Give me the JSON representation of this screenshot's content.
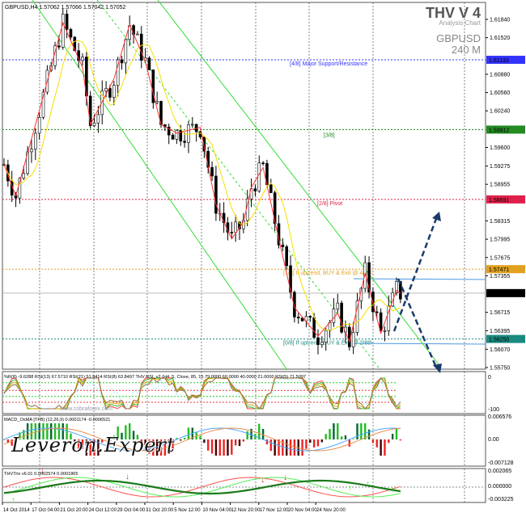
{
  "header": {
    "symbol_info": "GBPUSD,H4",
    "ohlc": "1.57062 1.57066 1.57042 1.57052"
  },
  "brand": {
    "title": "THV V 4",
    "subtitle": "Analysis Chart",
    "symbol": "GBPUSD",
    "timeframe": "240 M"
  },
  "price_axis": {
    "ticks": [
      "1.61840",
      "1.61520",
      "1.60880",
      "1.60560",
      "1.60240",
      "1.59600",
      "1.59275",
      "1.58955",
      "1.58315",
      "1.57995",
      "1.57675",
      "1.57355",
      "1.56715",
      "1.56395",
      "1.56070",
      "1.55750"
    ]
  },
  "levels": [
    {
      "price": "1.61133",
      "label": "[4/8] Major Support/Resistance",
      "color": "#3333ff"
    },
    {
      "price": "1.59912",
      "label": "[3/8]",
      "color": "#228b22"
    },
    {
      "price": "1.58691",
      "label": "[2/8] Pivot",
      "color": "#e0204a"
    },
    {
      "price": "1.57471",
      "label": "[1/8] If uptrend, BUY & Exit @ 4/8th",
      "color": "#e0a020"
    },
    {
      "price": "1.56250",
      "label": "[0/8] If uptrend, BUY & Exit @ 2/8th",
      "color": "#1a8a80"
    }
  ],
  "current_price": "1.57052",
  "price_path": [
    [
      0,
      1.593
    ],
    [
      3,
      1.5875
    ],
    [
      10,
      1.605
    ],
    [
      15,
      1.6178
    ],
    [
      20,
      1.61
    ],
    [
      22,
      1.6
    ],
    [
      28,
      1.608
    ],
    [
      32,
      1.6175
    ],
    [
      36,
      1.611
    ],
    [
      40,
      1.6
    ],
    [
      44,
      1.5985
    ],
    [
      50,
      1.5995
    ],
    [
      54,
      1.586
    ],
    [
      58,
      1.58
    ],
    [
      61,
      1.583
    ],
    [
      63,
      1.589
    ],
    [
      66,
      1.5925
    ],
    [
      70,
      1.58
    ],
    [
      74,
      1.568
    ],
    [
      80,
      1.563
    ],
    [
      85,
      1.567
    ],
    [
      88,
      1.562
    ],
    [
      92,
      1.574
    ],
    [
      96,
      1.5635
    ],
    [
      100,
      1.571
    ],
    [
      101,
      1.5705
    ]
  ],
  "rsi_panel": {
    "title": "%R(8) -9.6288  RSI(13) 67.5710  RSI(21) 51.9414  RSI(8) 63.8497     THV RSI_v2  (H4,  5,  Close,  85,  15 79.0000 60.0000 40.0000 21.0000  RSI(5) 71.5097",
    "axis_top": "0",
    "axis_bottom": "-100",
    "watermark": "www.cobraforex.com"
  },
  "macd_panel": {
    "title": "MACD_OsMA [TFB] (12,26,9)  0.0001174 -0.0006521",
    "axis": [
      "0.006576",
      "0.00",
      "-0.007128"
    ]
  },
  "trix_panel": {
    "title": "THVTrix v6.01 0.0002574 0.0001865",
    "axis": [
      "0.002065",
      "0.000000",
      "-0.003225"
    ]
  },
  "logo": "Leveron.Expert",
  "time_axis": [
    "14 Oct 2014",
    "17 Oct 04:00",
    "21 Oct 20:00",
    "24 Oct 12:00",
    "29 Oct 04:00",
    "31 Oct 20:00",
    "5 Nov 12:00",
    "10 Nov 04:00",
    "12 Nov 20:00",
    "17 Nov 12:00",
    "20 Nov 04:00",
    "24 Nov 20:00"
  ],
  "colors": {
    "bull_hist": "#22bb22",
    "bear_hist": "#ee2222",
    "channel": "#33dd33",
    "zigzag": "#ff3333",
    "arrow": "#1a3a6a"
  }
}
